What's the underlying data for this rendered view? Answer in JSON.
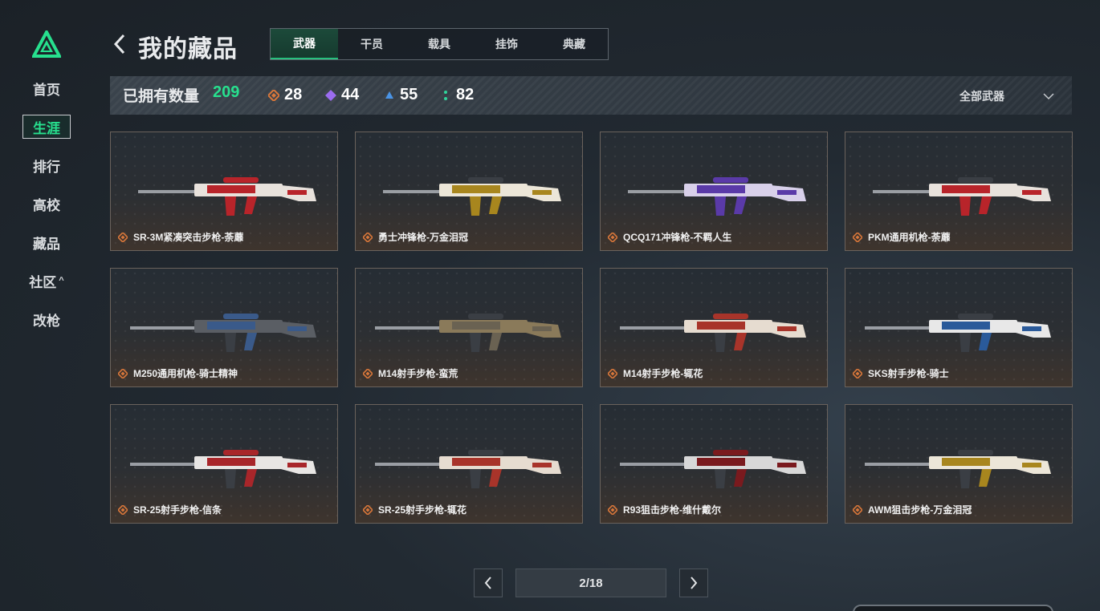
{
  "sidebar": {
    "items": [
      {
        "label": "首页"
      },
      {
        "label": "生涯"
      },
      {
        "label": "排行"
      },
      {
        "label": "高校"
      },
      {
        "label": "藏品"
      },
      {
        "label": "社区"
      },
      {
        "label": "改枪"
      }
    ]
  },
  "header": {
    "title": "我的藏品",
    "tabs": [
      {
        "label": "武器"
      },
      {
        "label": "干员"
      },
      {
        "label": "载具"
      },
      {
        "label": "挂饰"
      },
      {
        "label": "典藏"
      }
    ]
  },
  "stats": {
    "owned_label": "已拥有数量",
    "owned_count": "209",
    "rarities": [
      {
        "value": "28",
        "color": "#d9773a"
      },
      {
        "value": "44",
        "color": "#9b6cf0"
      },
      {
        "value": "55",
        "color": "#4a94e6"
      },
      {
        "value": "82",
        "color": "#2fd49a"
      }
    ],
    "filter_label": "全部武器"
  },
  "items": [
    {
      "name": "SR-3M紧凑突击步枪-荼蘼",
      "tier_color": "#d9773a",
      "palette": [
        "#b8242a",
        "#e8e2dc"
      ]
    },
    {
      "name": "勇士冲锋枪-万金泪冠",
      "tier_color": "#d9773a",
      "palette": [
        "#a8861e",
        "#ece6d8"
      ]
    },
    {
      "name": "QCQ171冲锋枪-不羁人生",
      "tier_color": "#d9773a",
      "palette": [
        "#5a3aa8",
        "#d8d0ea"
      ]
    },
    {
      "name": "PKM通用机枪-荼蘼",
      "tier_color": "#d9773a",
      "palette": [
        "#b8242a",
        "#e8e2dc"
      ]
    },
    {
      "name": "M250通用机枪-骑士精神",
      "tier_color": "#d9773a",
      "palette": [
        "#3a5a8a",
        "#5a5e64"
      ]
    },
    {
      "name": "M14射手步枪-蛮荒",
      "tier_color": "#d9773a",
      "palette": [
        "#6a6252",
        "#8a7a5a"
      ]
    },
    {
      "name": "M14射手步枪-辄花",
      "tier_color": "#d9773a",
      "palette": [
        "#a8342a",
        "#e6dcd0"
      ]
    },
    {
      "name": "SKS射手步枪-骑士",
      "tier_color": "#d9773a",
      "palette": [
        "#2a5a9a",
        "#e8e8e8"
      ]
    },
    {
      "name": "SR-25射手步枪-信条",
      "tier_color": "#d9773a",
      "palette": [
        "#a8262a",
        "#e8e6e4"
      ]
    },
    {
      "name": "SR-25射手步枪-辄花",
      "tier_color": "#d9773a",
      "palette": [
        "#a8342a",
        "#e6dcd0"
      ]
    },
    {
      "name": "R93狙击步枪-维什戴尔",
      "tier_color": "#d9773a",
      "palette": [
        "#7a1a1e",
        "#d8d8d8"
      ]
    },
    {
      "name": "AWM狙击步枪-万金泪冠",
      "tier_color": "#d9773a",
      "palette": [
        "#a8861e",
        "#ece6d8"
      ]
    }
  ],
  "pagination": {
    "page_text": "2/18"
  },
  "colors": {
    "accent": "#27e08e",
    "card_border": "#6a625c"
  },
  "icons": {
    "logo": "triangle-logo-icon",
    "back": "chevron-left-icon",
    "dropdown": "chevron-down-icon",
    "prev": "chevron-left-icon",
    "next": "chevron-right-icon",
    "tier": "diamond-tier-icon"
  }
}
